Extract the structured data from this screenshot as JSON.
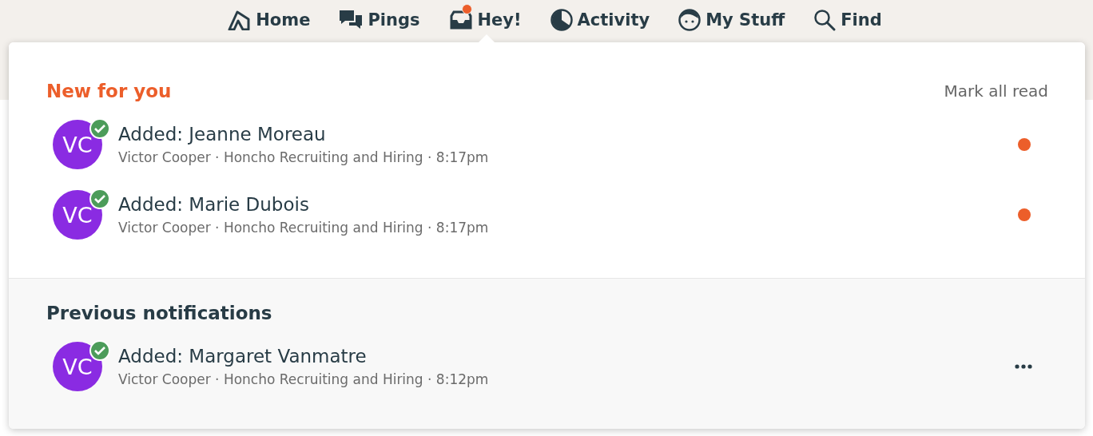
{
  "nav": [
    {
      "label": "Home",
      "kind": "home",
      "selected": false,
      "badge": false
    },
    {
      "label": "Pings",
      "kind": "pings",
      "selected": false,
      "badge": false
    },
    {
      "label": "Hey!",
      "kind": "hey",
      "selected": true,
      "badge": true
    },
    {
      "label": "Activity",
      "kind": "activity",
      "selected": false,
      "badge": false
    },
    {
      "label": "My Stuff",
      "kind": "face",
      "selected": false,
      "badge": false
    },
    {
      "label": "Find",
      "kind": "search",
      "selected": false,
      "badge": false
    }
  ],
  "new_section": {
    "title": "New for you",
    "action": "Mark all read",
    "items": [
      {
        "initials": "VC",
        "title": "Added: Jeanne Moreau",
        "meta": "Victor Cooper · Honcho Recruiting and Hiring · 8:17pm",
        "unread": true
      },
      {
        "initials": "VC",
        "title": "Added: Marie Dubois",
        "meta": "Victor Cooper · Honcho Recruiting and Hiring · 8:17pm",
        "unread": true
      }
    ]
  },
  "previous_section": {
    "title": "Previous notifications",
    "items": [
      {
        "initials": "VC",
        "title": "Added: Margaret Vanmatre",
        "meta": "Victor Cooper · Honcho Recruiting and Hiring · 8:12pm",
        "unread": false
      }
    ]
  }
}
